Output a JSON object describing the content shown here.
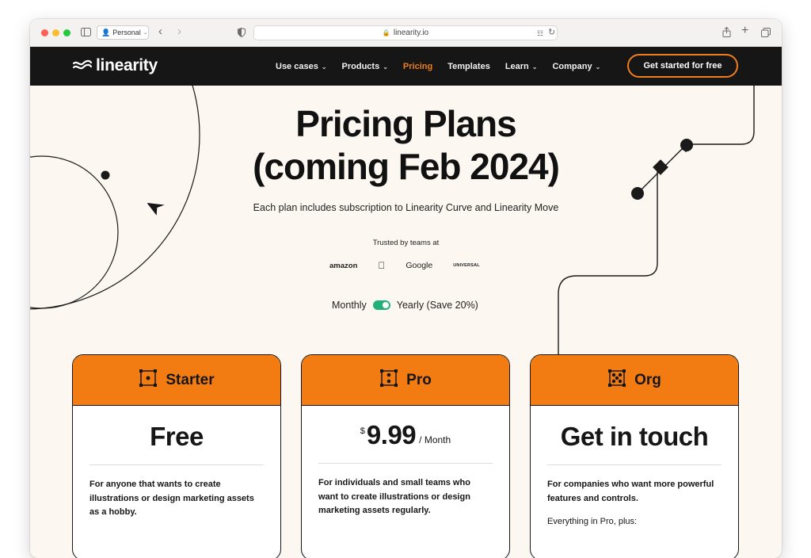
{
  "browser": {
    "profile_label": "Personal",
    "url": "linearity.io"
  },
  "nav": {
    "logo_text": "linearity",
    "links": [
      {
        "label": "Use cases",
        "has_caret": true
      },
      {
        "label": "Products",
        "has_caret": true
      },
      {
        "label": "Pricing",
        "active": true
      },
      {
        "label": "Templates"
      },
      {
        "label": "Learn",
        "has_caret": true
      },
      {
        "label": "Company",
        "has_caret": true
      }
    ],
    "cta_label": "Get started for free"
  },
  "hero": {
    "title_line1": "Pricing Plans",
    "title_line2": "(coming Feb 2024)",
    "subtitle": "Each plan includes subscription to Linearity Curve and Linearity Move",
    "trusted_label": "Trusted by teams at",
    "logos": [
      "amazon",
      "apple",
      "Google",
      "UNIVERSAL"
    ]
  },
  "billing_toggle": {
    "monthly_label": "Monthly",
    "yearly_label": "Yearly (Save 20%)",
    "selected": "yearly"
  },
  "plans": [
    {
      "name": "Starter",
      "price": "Free",
      "description": "For anyone that wants to create illustrations or design marketing assets as a hobby."
    },
    {
      "name": "Pro",
      "currency": "$",
      "amount": "9.99",
      "period": "/ Month",
      "description": "For individuals and small teams who want to create illustrations or design marketing assets regularly."
    },
    {
      "name": "Org",
      "price": "Get in touch",
      "description": "For companies who want more powerful features and controls.",
      "extra": "Everything in Pro, plus:"
    }
  ],
  "colors": {
    "accent": "#f37c12",
    "nav_bg": "#161616",
    "page_bg": "#fcf7f1",
    "toggle_on": "#22b07a"
  }
}
